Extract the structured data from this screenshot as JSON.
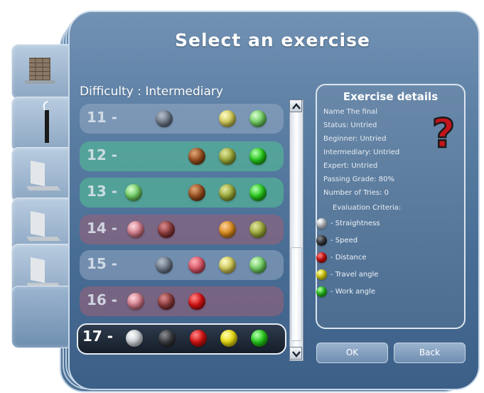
{
  "title": "Select an exercise",
  "difficulty_label": "Difficulty : Intermediary",
  "rows": [
    {
      "num": "11 -"
    },
    {
      "num": "12 -"
    },
    {
      "num": "13 -"
    },
    {
      "num": "14 -"
    },
    {
      "num": "15 -"
    },
    {
      "num": "16 -"
    },
    {
      "num": "17 -"
    }
  ],
  "details": {
    "title": "Exercise details",
    "name": "Name  The final",
    "status": "Status: Untried",
    "beginner": "Beginner: Untried",
    "intermediary": "Intermediary: Untried",
    "expert": "Expert: Untried",
    "passing_grade": "Passing Grade: 80%",
    "tries": "Number of Tries: 0",
    "evaluation_title": "Evaluation Criteria:",
    "legend": [
      {
        "label": "- Straightness",
        "icon": "white-ball-icon"
      },
      {
        "label": "- Speed",
        "icon": "black-ball-icon"
      },
      {
        "label": "- Distance",
        "icon": "red-ball-icon"
      },
      {
        "label": "- Travel angle",
        "icon": "yellow-ball-icon"
      },
      {
        "label": "- Work angle",
        "icon": "green-ball-icon"
      }
    ]
  },
  "buttons": {
    "ok": "OK",
    "back": "Back"
  },
  "colors": {
    "accent": "#5b7ea3",
    "row_green": "#53b896",
    "row_mauve": "#98607a",
    "qmark": "#c4141c"
  }
}
